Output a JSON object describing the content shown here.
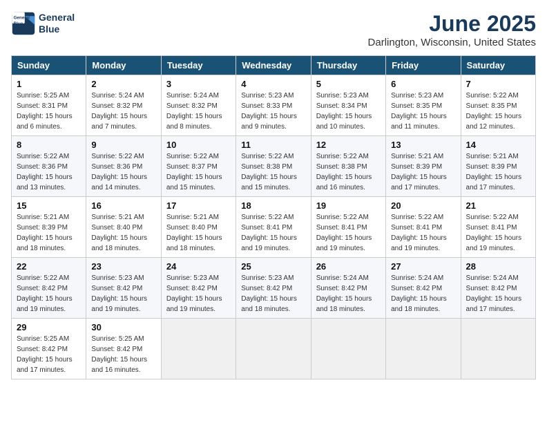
{
  "header": {
    "logo_line1": "General",
    "logo_line2": "Blue",
    "month": "June 2025",
    "location": "Darlington, Wisconsin, United States"
  },
  "weekdays": [
    "Sunday",
    "Monday",
    "Tuesday",
    "Wednesday",
    "Thursday",
    "Friday",
    "Saturday"
  ],
  "weeks": [
    [
      {
        "day": "1",
        "sunrise": "5:25 AM",
        "sunset": "8:31 PM",
        "daylight": "15 hours and 6 minutes."
      },
      {
        "day": "2",
        "sunrise": "5:24 AM",
        "sunset": "8:32 PM",
        "daylight": "15 hours and 7 minutes."
      },
      {
        "day": "3",
        "sunrise": "5:24 AM",
        "sunset": "8:32 PM",
        "daylight": "15 hours and 8 minutes."
      },
      {
        "day": "4",
        "sunrise": "5:23 AM",
        "sunset": "8:33 PM",
        "daylight": "15 hours and 9 minutes."
      },
      {
        "day": "5",
        "sunrise": "5:23 AM",
        "sunset": "8:34 PM",
        "daylight": "15 hours and 10 minutes."
      },
      {
        "day": "6",
        "sunrise": "5:23 AM",
        "sunset": "8:35 PM",
        "daylight": "15 hours and 11 minutes."
      },
      {
        "day": "7",
        "sunrise": "5:22 AM",
        "sunset": "8:35 PM",
        "daylight": "15 hours and 12 minutes."
      }
    ],
    [
      {
        "day": "8",
        "sunrise": "5:22 AM",
        "sunset": "8:36 PM",
        "daylight": "15 hours and 13 minutes."
      },
      {
        "day": "9",
        "sunrise": "5:22 AM",
        "sunset": "8:36 PM",
        "daylight": "15 hours and 14 minutes."
      },
      {
        "day": "10",
        "sunrise": "5:22 AM",
        "sunset": "8:37 PM",
        "daylight": "15 hours and 15 minutes."
      },
      {
        "day": "11",
        "sunrise": "5:22 AM",
        "sunset": "8:38 PM",
        "daylight": "15 hours and 15 minutes."
      },
      {
        "day": "12",
        "sunrise": "5:22 AM",
        "sunset": "8:38 PM",
        "daylight": "15 hours and 16 minutes."
      },
      {
        "day": "13",
        "sunrise": "5:21 AM",
        "sunset": "8:39 PM",
        "daylight": "15 hours and 17 minutes."
      },
      {
        "day": "14",
        "sunrise": "5:21 AM",
        "sunset": "8:39 PM",
        "daylight": "15 hours and 17 minutes."
      }
    ],
    [
      {
        "day": "15",
        "sunrise": "5:21 AM",
        "sunset": "8:39 PM",
        "daylight": "15 hours and 18 minutes."
      },
      {
        "day": "16",
        "sunrise": "5:21 AM",
        "sunset": "8:40 PM",
        "daylight": "15 hours and 18 minutes."
      },
      {
        "day": "17",
        "sunrise": "5:21 AM",
        "sunset": "8:40 PM",
        "daylight": "15 hours and 18 minutes."
      },
      {
        "day": "18",
        "sunrise": "5:22 AM",
        "sunset": "8:41 PM",
        "daylight": "15 hours and 19 minutes."
      },
      {
        "day": "19",
        "sunrise": "5:22 AM",
        "sunset": "8:41 PM",
        "daylight": "15 hours and 19 minutes."
      },
      {
        "day": "20",
        "sunrise": "5:22 AM",
        "sunset": "8:41 PM",
        "daylight": "15 hours and 19 minutes."
      },
      {
        "day": "21",
        "sunrise": "5:22 AM",
        "sunset": "8:41 PM",
        "daylight": "15 hours and 19 minutes."
      }
    ],
    [
      {
        "day": "22",
        "sunrise": "5:22 AM",
        "sunset": "8:42 PM",
        "daylight": "15 hours and 19 minutes."
      },
      {
        "day": "23",
        "sunrise": "5:23 AM",
        "sunset": "8:42 PM",
        "daylight": "15 hours and 19 minutes."
      },
      {
        "day": "24",
        "sunrise": "5:23 AM",
        "sunset": "8:42 PM",
        "daylight": "15 hours and 19 minutes."
      },
      {
        "day": "25",
        "sunrise": "5:23 AM",
        "sunset": "8:42 PM",
        "daylight": "15 hours and 18 minutes."
      },
      {
        "day": "26",
        "sunrise": "5:24 AM",
        "sunset": "8:42 PM",
        "daylight": "15 hours and 18 minutes."
      },
      {
        "day": "27",
        "sunrise": "5:24 AM",
        "sunset": "8:42 PM",
        "daylight": "15 hours and 18 minutes."
      },
      {
        "day": "28",
        "sunrise": "5:24 AM",
        "sunset": "8:42 PM",
        "daylight": "15 hours and 17 minutes."
      }
    ],
    [
      {
        "day": "29",
        "sunrise": "5:25 AM",
        "sunset": "8:42 PM",
        "daylight": "15 hours and 17 minutes."
      },
      {
        "day": "30",
        "sunrise": "5:25 AM",
        "sunset": "8:42 PM",
        "daylight": "15 hours and 16 minutes."
      },
      null,
      null,
      null,
      null,
      null
    ]
  ],
  "labels": {
    "sunrise": "Sunrise:",
    "sunset": "Sunset:",
    "daylight": "Daylight:"
  }
}
